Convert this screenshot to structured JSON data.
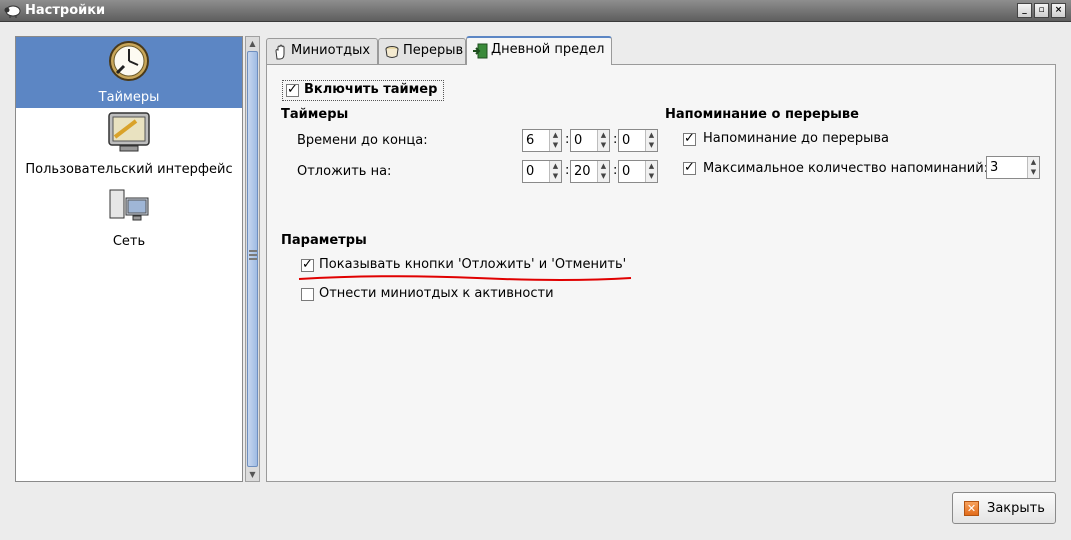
{
  "window": {
    "title": "Настройки",
    "buttons": {
      "minimize": "_",
      "maximize": "▫",
      "close": "×"
    }
  },
  "sidebar": {
    "items": [
      {
        "label": "Таймеры",
        "icon": "clock-icon",
        "selected": true
      },
      {
        "label": "Пользовательский интерфейс",
        "icon": "monitor-icon",
        "selected": false
      },
      {
        "label": "Сеть",
        "icon": "network-icon",
        "selected": false
      }
    ]
  },
  "tabs": [
    {
      "label": "Миниотдых",
      "icon": "hand-icon",
      "active": false
    },
    {
      "label": "Перерыв",
      "icon": "coffee-cup-icon",
      "active": false
    },
    {
      "label": "Дневной предел",
      "icon": "exit-door-icon",
      "active": true
    }
  ],
  "panel": {
    "enable_timer": {
      "label": "Включить таймер",
      "checked": true
    },
    "timers": {
      "heading": "Таймеры",
      "time_left": {
        "label": "Времени до конца:",
        "hours": "6",
        "minutes": "0",
        "seconds": "0"
      },
      "postpone": {
        "label": "Отложить на:",
        "hours": "0",
        "minutes": "20",
        "seconds": "0"
      },
      "separator": ":"
    },
    "reminder": {
      "heading": "Напоминание о перерыве",
      "before_break": {
        "label": "Напоминание до перерыва",
        "checked": true
      },
      "max_count": {
        "label": "Максимальное количество напоминаний:",
        "checked": true,
        "value": "3"
      }
    },
    "params": {
      "heading": "Параметры",
      "show_buttons": {
        "label": "Показывать кнопки 'Отложить' и 'Отменить'",
        "checked": true
      },
      "count_as_activity": {
        "label": "Отнести миниотдых к активности",
        "checked": false
      }
    }
  },
  "footer": {
    "close_label": "Закрыть"
  },
  "colors": {
    "accent": "#5c86c4",
    "annotation_underline": "#e00000"
  }
}
